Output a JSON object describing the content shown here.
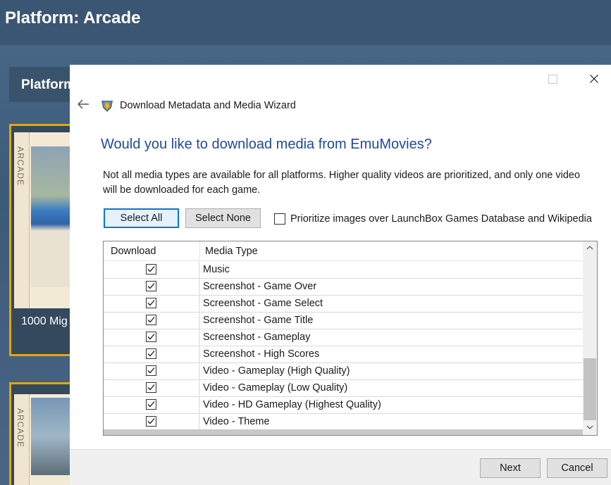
{
  "background": {
    "title": "Platform: Arcade",
    "panel_label": "Platform",
    "tile_spine_text": "ARCADE",
    "tile_label": "1000 Mig"
  },
  "dialog": {
    "title": "Download Metadata and Media Wizard",
    "question": "Would you like to download media from EmuMovies?",
    "description": "Not all media types are available for all platforms. Higher quality videos are prioritized, and only one video will be downloaded for each game.",
    "select_all": "Select All",
    "select_none": "Select None",
    "prioritize_label": "Prioritize images over LaunchBox Games Database and Wikipedia",
    "prioritize_checked": false,
    "grid": {
      "col_download": "Download",
      "col_media_type": "Media Type",
      "rows": [
        {
          "checked": true,
          "name": "Music"
        },
        {
          "checked": true,
          "name": "Screenshot - Game Over"
        },
        {
          "checked": true,
          "name": "Screenshot - Game Select"
        },
        {
          "checked": true,
          "name": "Screenshot - Game Title"
        },
        {
          "checked": true,
          "name": "Screenshot - Gameplay"
        },
        {
          "checked": true,
          "name": "Screenshot - High Scores"
        },
        {
          "checked": true,
          "name": "Video - Gameplay (High Quality)"
        },
        {
          "checked": true,
          "name": "Video - Gameplay (Low Quality)"
        },
        {
          "checked": true,
          "name": "Video - HD Gameplay (Highest Quality)"
        },
        {
          "checked": true,
          "name": "Video - Theme"
        }
      ]
    },
    "next": "Next",
    "cancel": "Cancel"
  },
  "colors": {
    "accent": "#0078d7",
    "question": "#1f4a9a",
    "tile_border": "#e0a80a"
  }
}
